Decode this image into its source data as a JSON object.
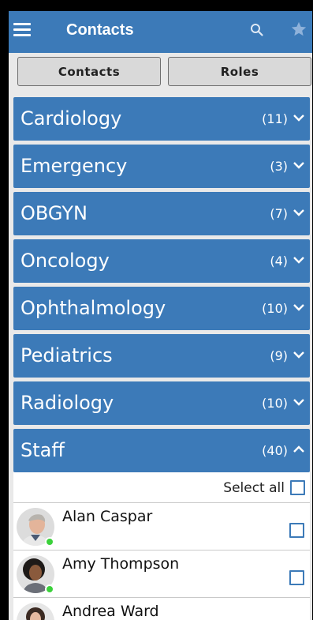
{
  "header": {
    "title": "Contacts",
    "menu_icon": "hamburger-menu-icon",
    "search_icon": "search-icon",
    "favorite_icon": "star-icon"
  },
  "tabs": [
    {
      "label": "Contacts"
    },
    {
      "label": "Roles"
    }
  ],
  "groups": [
    {
      "name": "Cardiology",
      "count": "(11)",
      "expanded": false
    },
    {
      "name": "Emergency",
      "count": "(3)",
      "expanded": false
    },
    {
      "name": "OBGYN",
      "count": "(7)",
      "expanded": false
    },
    {
      "name": "Oncology",
      "count": "(4)",
      "expanded": false
    },
    {
      "name": "Ophthalmology",
      "count": "(10)",
      "expanded": false
    },
    {
      "name": "Pediatrics",
      "count": "(9)",
      "expanded": false
    },
    {
      "name": "Radiology",
      "count": "(10)",
      "expanded": false
    },
    {
      "name": "Staff",
      "count": "(40)",
      "expanded": true
    }
  ],
  "staff_list": {
    "select_all_label": "Select all",
    "contacts": [
      {
        "name": "Alan Caspar",
        "online": true
      },
      {
        "name": "Amy Thompson",
        "online": true
      },
      {
        "name": "Andrea Ward",
        "online": false
      }
    ]
  },
  "colors": {
    "primary": "#3c7ab8",
    "background": "#e9e9e9",
    "presence_online": "#3bd13b"
  }
}
